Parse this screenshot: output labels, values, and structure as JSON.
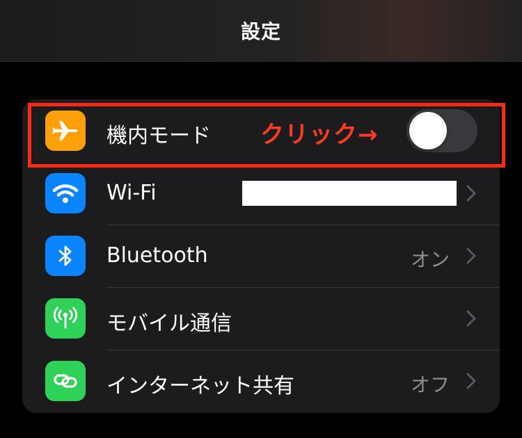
{
  "header": {
    "title": "設定"
  },
  "settings": {
    "rows": [
      {
        "label": "機内モード",
        "icon": "airplane-icon",
        "color": "#ff9f0a",
        "toggle": "off"
      },
      {
        "label": "Wi-Fi",
        "icon": "wifi-icon",
        "color": "#0a84ff",
        "value": ""
      },
      {
        "label": "Bluetooth",
        "icon": "bluetooth-icon",
        "color": "#0a84ff",
        "value": "オン"
      },
      {
        "label": "モバイル通信",
        "icon": "antenna-icon",
        "color": "#30d158",
        "value": ""
      },
      {
        "label": "インターネット共有",
        "icon": "link-icon",
        "color": "#30d158",
        "value": "オフ"
      }
    ]
  },
  "annotation": {
    "text": "クリック→",
    "color": "#ff2a14"
  },
  "colors": {
    "background": "#000000",
    "group_background": "#1c1c1e",
    "secondary_text": "#8e8e93",
    "toggle_off": "#39393d"
  }
}
